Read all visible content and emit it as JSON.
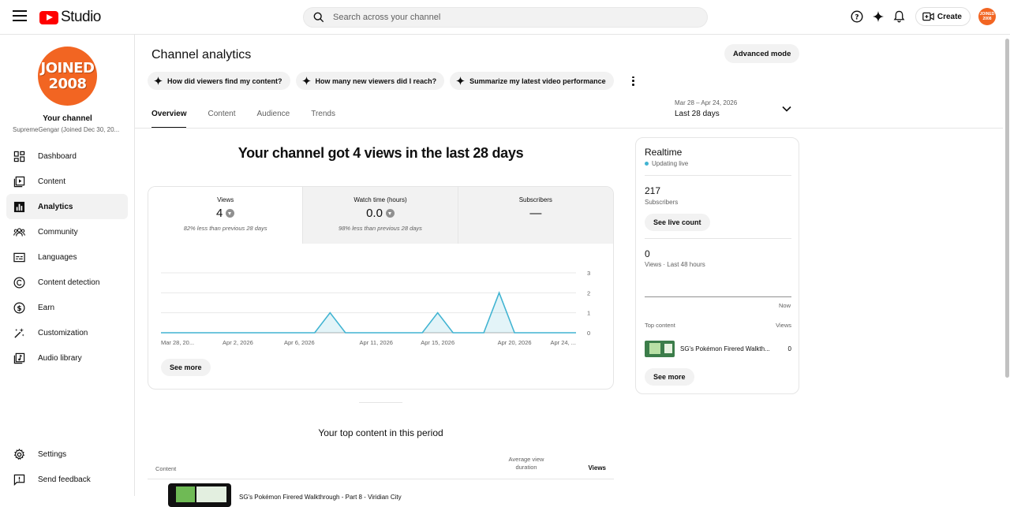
{
  "app": {
    "logo_text": "Studio",
    "avatar_text": "JOINED 2008"
  },
  "search": {
    "placeholder": "Search across your channel"
  },
  "topbar": {
    "create_label": "Create"
  },
  "channel": {
    "avatar_line1": "JOINED",
    "avatar_line2": "2008",
    "title": "Your channel",
    "subtitle": "SupremeGengar (Joined Dec 30, 20..."
  },
  "sidebar": {
    "items": [
      {
        "label": "Dashboard",
        "icon": "dashboard-icon"
      },
      {
        "label": "Content",
        "icon": "content-icon"
      },
      {
        "label": "Analytics",
        "icon": "analytics-icon",
        "active": true
      },
      {
        "label": "Community",
        "icon": "community-icon"
      },
      {
        "label": "Languages",
        "icon": "languages-icon"
      },
      {
        "label": "Content detection",
        "icon": "copyright-icon"
      },
      {
        "label": "Earn",
        "icon": "dollar-icon"
      },
      {
        "label": "Customization",
        "icon": "magic-wand-icon"
      },
      {
        "label": "Audio library",
        "icon": "audio-library-icon"
      }
    ],
    "settings_label": "Settings",
    "feedback_label": "Send feedback"
  },
  "main": {
    "title": "Channel analytics",
    "advanced_mode_label": "Advanced mode",
    "chips": [
      "How did viewers find my content?",
      "How many new viewers did I reach?",
      "Summarize my latest video performance"
    ],
    "tabs": [
      "Overview",
      "Content",
      "Audience",
      "Trends"
    ],
    "date_range": {
      "dates": "Mar 28 – Apr 24, 2026",
      "label": "Last 28 days"
    },
    "headline": "Your channel got 4 views in the last 28 days",
    "metrics": [
      {
        "label": "Views",
        "value": "4",
        "compare": "82% less than previous 28 days"
      },
      {
        "label": "Watch time (hours)",
        "value": "0.0",
        "compare": "98% less than previous 28 days"
      },
      {
        "label": "Subscribers",
        "value": "—",
        "compare": ""
      }
    ],
    "see_more_label": "See more"
  },
  "chart_data": {
    "type": "area",
    "x_tick_labels": [
      "Mar 28, 20...",
      "Apr 2, 2026",
      "Apr 6, 2026",
      "Apr 11, 2026",
      "Apr 15, 2026",
      "Apr 20, 2026",
      "Apr 24, ..."
    ],
    "y_ticks": [
      0,
      1,
      2,
      3
    ],
    "ylim": [
      0,
      3
    ],
    "series": [
      {
        "x": [
          "Mar 28",
          "Mar 29",
          "Mar 30",
          "Mar 31",
          "Apr 1",
          "Apr 2",
          "Apr 3",
          "Apr 4",
          "Apr 5",
          "Apr 6",
          "Apr 7",
          "Apr 8",
          "Apr 9",
          "Apr 10",
          "Apr 11",
          "Apr 12",
          "Apr 13",
          "Apr 14",
          "Apr 15",
          "Apr 16",
          "Apr 17",
          "Apr 18",
          "Apr 19",
          "Apr 20",
          "Apr 21",
          "Apr 22",
          "Apr 23",
          "Apr 24"
        ],
        "values": [
          0,
          0,
          0,
          0,
          0,
          0,
          0,
          0,
          0,
          0,
          0,
          1,
          0,
          0,
          0,
          0,
          0,
          0,
          1,
          0,
          0,
          0,
          2,
          0,
          0,
          0,
          0,
          0
        ]
      }
    ],
    "color": "#41b4d2",
    "grid": true
  },
  "realtime": {
    "title": "Realtime",
    "status": "Updating live",
    "subscribers_value": "217",
    "subscribers_label": "Subscribers",
    "live_count_label": "See live count",
    "views_value": "0",
    "views_label": "Views · Last 48 hours",
    "now_label": "Now",
    "top_content_label": "Top content",
    "views_col_label": "Views",
    "top_item": {
      "title": "SG's Pokémon Firered Walkth...",
      "views": "0"
    },
    "see_more_label": "See more"
  },
  "top_content": {
    "title": "Your top content in this period",
    "columns": {
      "content": "Content",
      "avg_line1": "Average view",
      "avg_line2": "duration",
      "views": "Views"
    },
    "rows": [
      {
        "title": "SG's Pokémon Firered Walkthrough - Part 8 - Viridian City"
      }
    ]
  }
}
